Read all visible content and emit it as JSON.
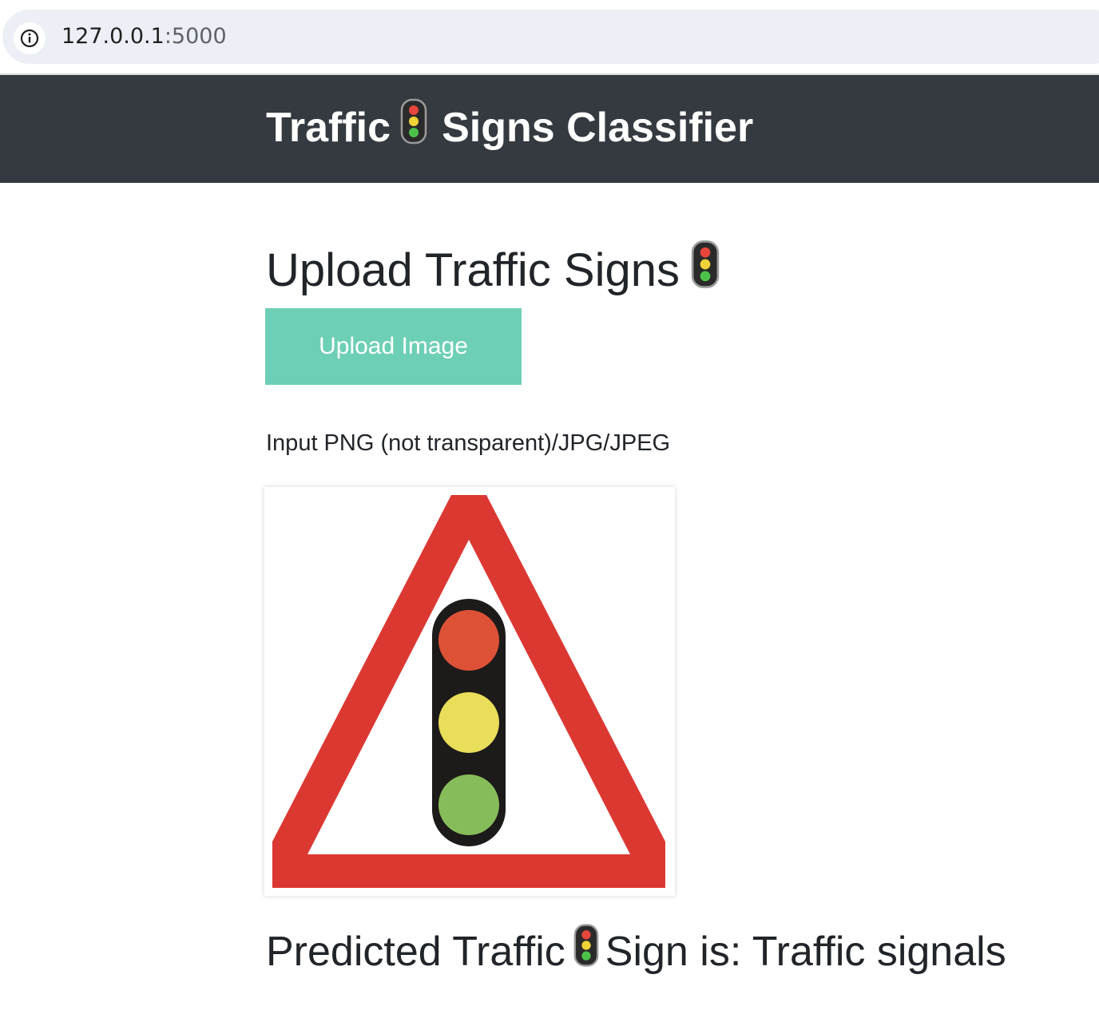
{
  "browser": {
    "url_host": "127.0.0.1",
    "url_port": ":5000"
  },
  "navbar": {
    "brand_part1": "Traffic",
    "brand_icon": "traffic-light-icon",
    "brand_part2": "Signs Classifier"
  },
  "main": {
    "heading": "Upload Traffic Signs",
    "heading_icon": "traffic-light-icon",
    "upload_button_label": "Upload Image",
    "input_hint": "Input PNG (not transparent)/JPG/JPEG",
    "uploaded_image": "traffic-signals-warning-sign",
    "result_part1": "Predicted Traffic",
    "result_icon": "traffic-light-icon",
    "result_part2": "Sign is: Traffic signals"
  },
  "colors": {
    "navbar_bg": "#343a40",
    "button_bg": "#6dcfb6",
    "sign_red": "#dc3832"
  }
}
